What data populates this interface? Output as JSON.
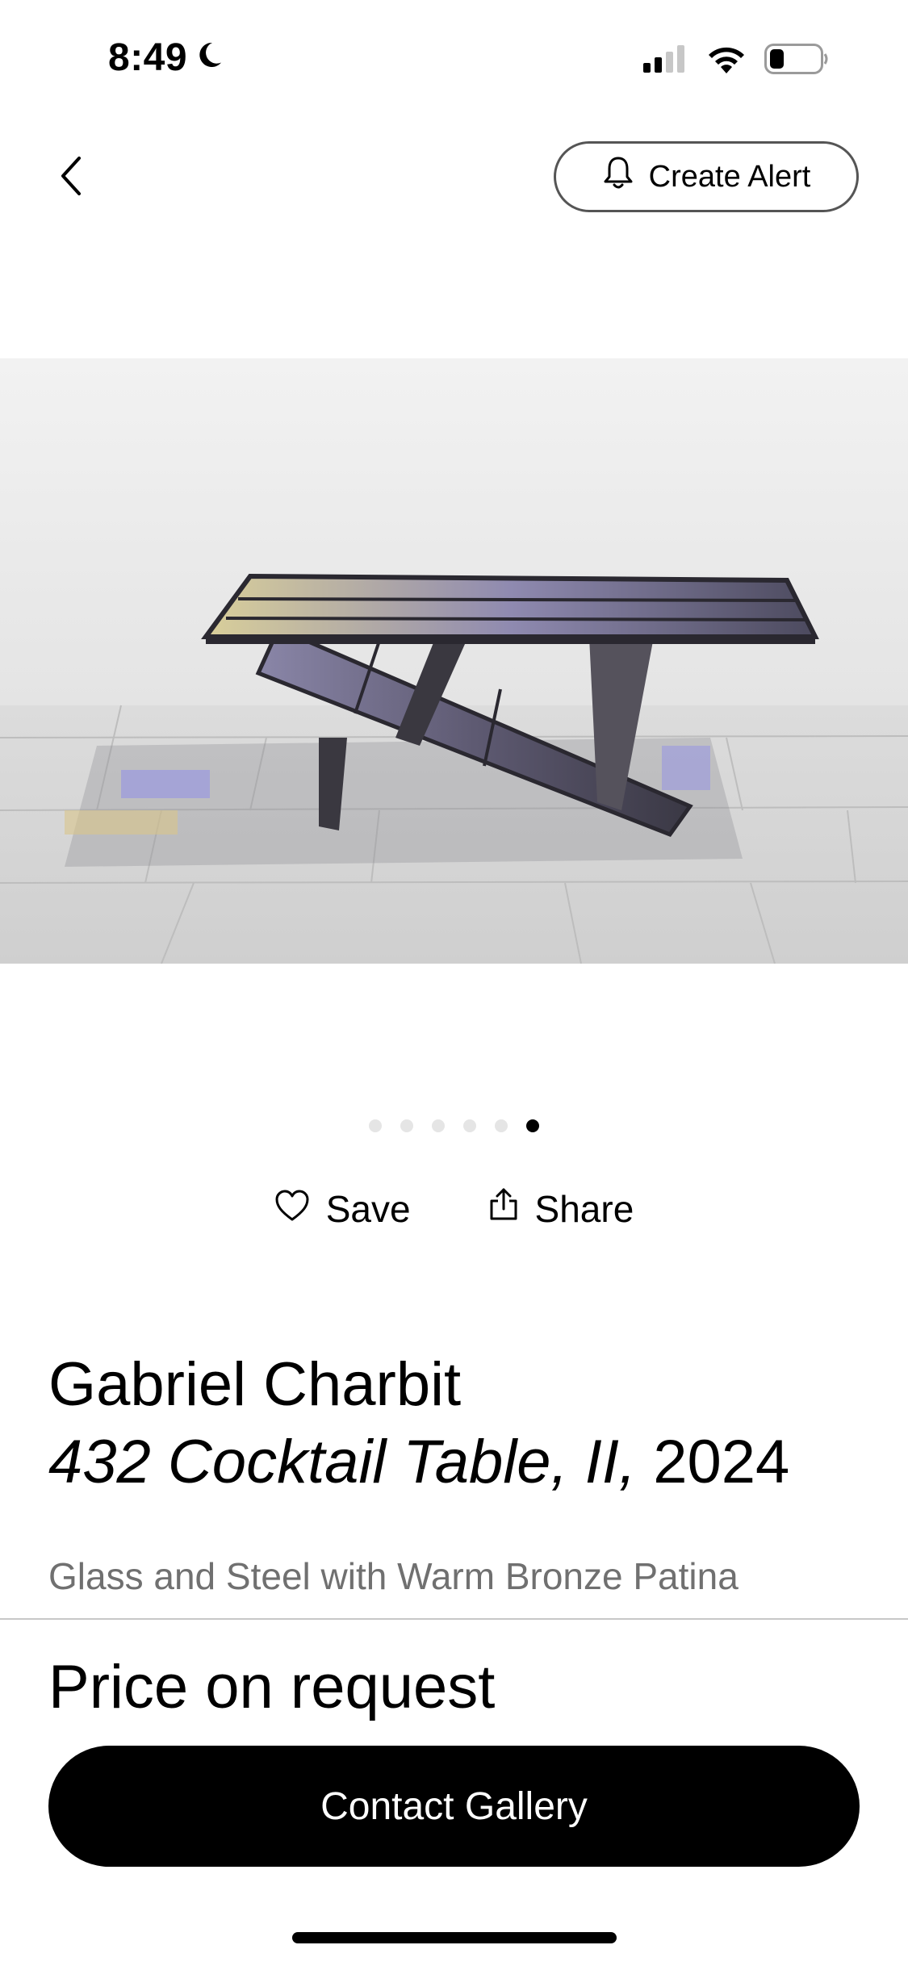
{
  "status_bar": {
    "time": "8:49",
    "moon_icon": "moon-icon",
    "signal_icon": "cellular-signal-icon",
    "wifi_icon": "wifi-icon",
    "battery_icon": "battery-icon",
    "battery_level": 0.2
  },
  "nav": {
    "back_icon": "chevron-left-icon",
    "create_alert_label": "Create Alert",
    "bell_icon": "bell-icon"
  },
  "gallery": {
    "image_count": 6,
    "active_index": 5
  },
  "actions": {
    "save_label": "Save",
    "save_icon": "heart-icon",
    "share_label": "Share",
    "share_icon": "share-icon"
  },
  "artwork": {
    "artist": "Gabriel Charbit",
    "title": "432 Cocktail Table, II,",
    "year": "2024",
    "medium": "Glass and Steel with Warm Bronze Patina",
    "price": "Price on request"
  },
  "cta": {
    "contact_label": "Contact Gallery"
  },
  "colors": {
    "primary": "#000000",
    "background": "#ffffff",
    "muted_text": "#707070",
    "dot_inactive": "#e5e5e5"
  }
}
